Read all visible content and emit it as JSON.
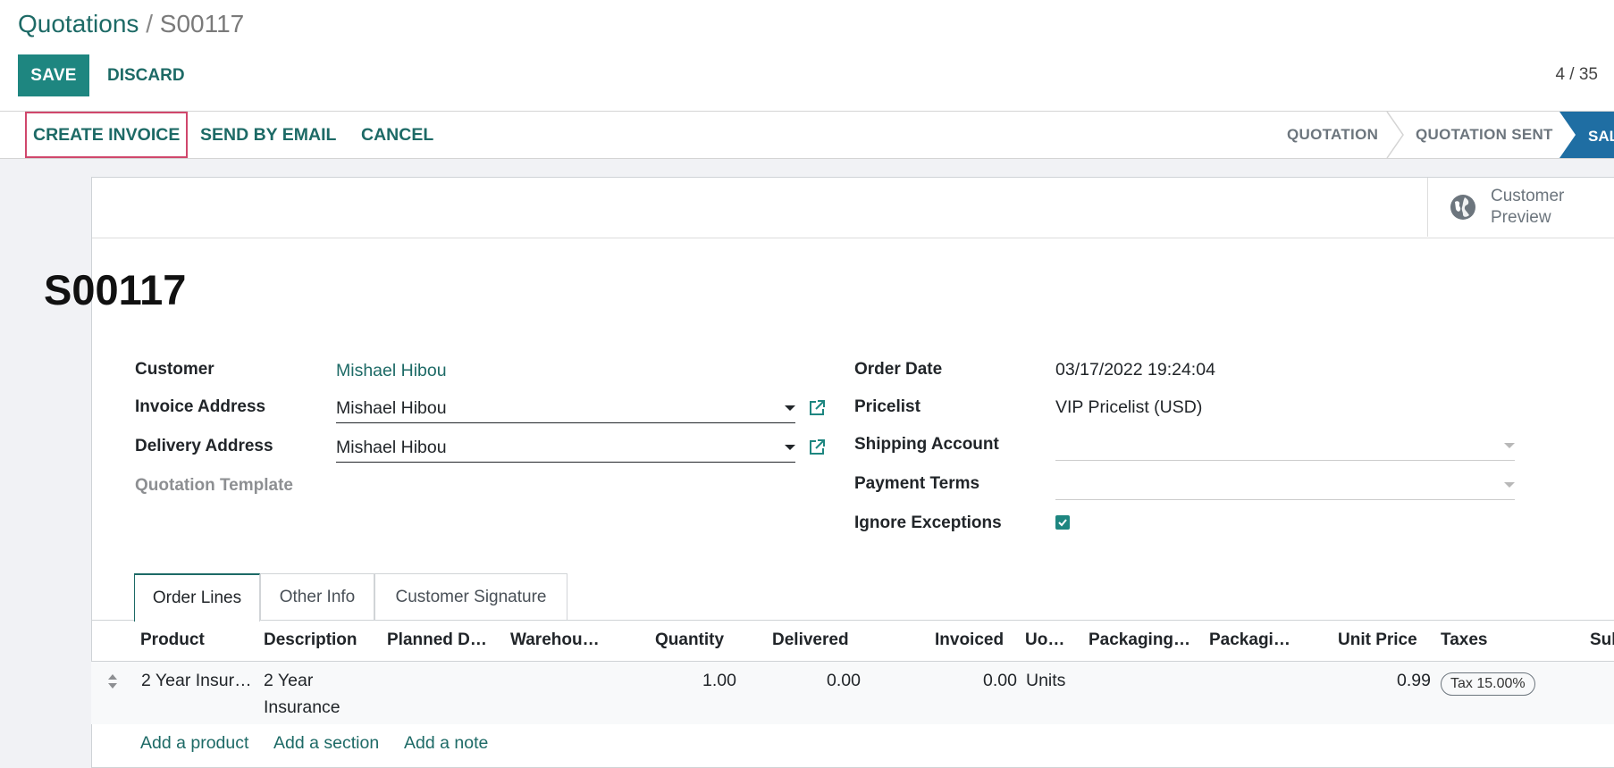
{
  "breadcrumb": {
    "parent": "Quotations",
    "separator": " / ",
    "current": "S00117"
  },
  "toolbar": {
    "save_label": "SAVE",
    "discard_label": "DISCARD",
    "pager": "4 / 35"
  },
  "actions": {
    "create_invoice": "CREATE INVOICE",
    "send_email": "SEND BY EMAIL",
    "cancel": "CANCEL"
  },
  "stages": {
    "quotation": "QUOTATION",
    "quotation_sent": "QUOTATION SENT",
    "sales_order": "SAL"
  },
  "colors": {
    "brand": "#1e8680",
    "link": "#1d6a66",
    "active_stage": "#1f6ea3",
    "highlight": "#d0476c"
  },
  "smart_button": {
    "icon": "globe-icon",
    "label_line1": "Customer",
    "label_line2": "Preview"
  },
  "order": {
    "name": "S00117",
    "left": {
      "customer_label": "Customer",
      "customer_value": "Mishael Hibou",
      "invoice_address_label": "Invoice Address",
      "invoice_address_value": "Mishael Hibou",
      "delivery_address_label": "Delivery Address",
      "delivery_address_value": "Mishael Hibou",
      "quotation_template_label": "Quotation Template"
    },
    "right": {
      "order_date_label": "Order Date",
      "order_date_value": "03/17/2022 19:24:04",
      "pricelist_label": "Pricelist",
      "pricelist_value": "VIP Pricelist (USD)",
      "shipping_account_label": "Shipping Account",
      "payment_terms_label": "Payment Terms",
      "ignore_exceptions_label": "Ignore Exceptions",
      "ignore_exceptions_checked": true
    }
  },
  "tabs": {
    "order_lines": "Order Lines",
    "other_info": "Other Info",
    "customer_signature": "Customer Signature"
  },
  "table": {
    "headers": {
      "product": "Product",
      "description": "Description",
      "planned_date": "Planned D…",
      "warehouse": "Warehou…",
      "quantity": "Quantity",
      "delivered": "Delivered",
      "invoiced": "Invoiced",
      "uom": "Uo…",
      "packaging_qty": "Packaging…",
      "packaging": "Packagi…",
      "unit_price": "Unit Price",
      "taxes": "Taxes",
      "subtotal": "Sub"
    },
    "rows": [
      {
        "product": "2 Year Insur…",
        "description_line1": "2 Year",
        "description_line2": "Insurance",
        "quantity": "1.00",
        "delivered": "0.00",
        "invoiced": "0.00",
        "uom": "Units",
        "unit_price": "0.99",
        "tax": "Tax 15.00%"
      }
    ],
    "add_product": "Add a product",
    "add_section": "Add a section",
    "add_note": "Add a note"
  }
}
